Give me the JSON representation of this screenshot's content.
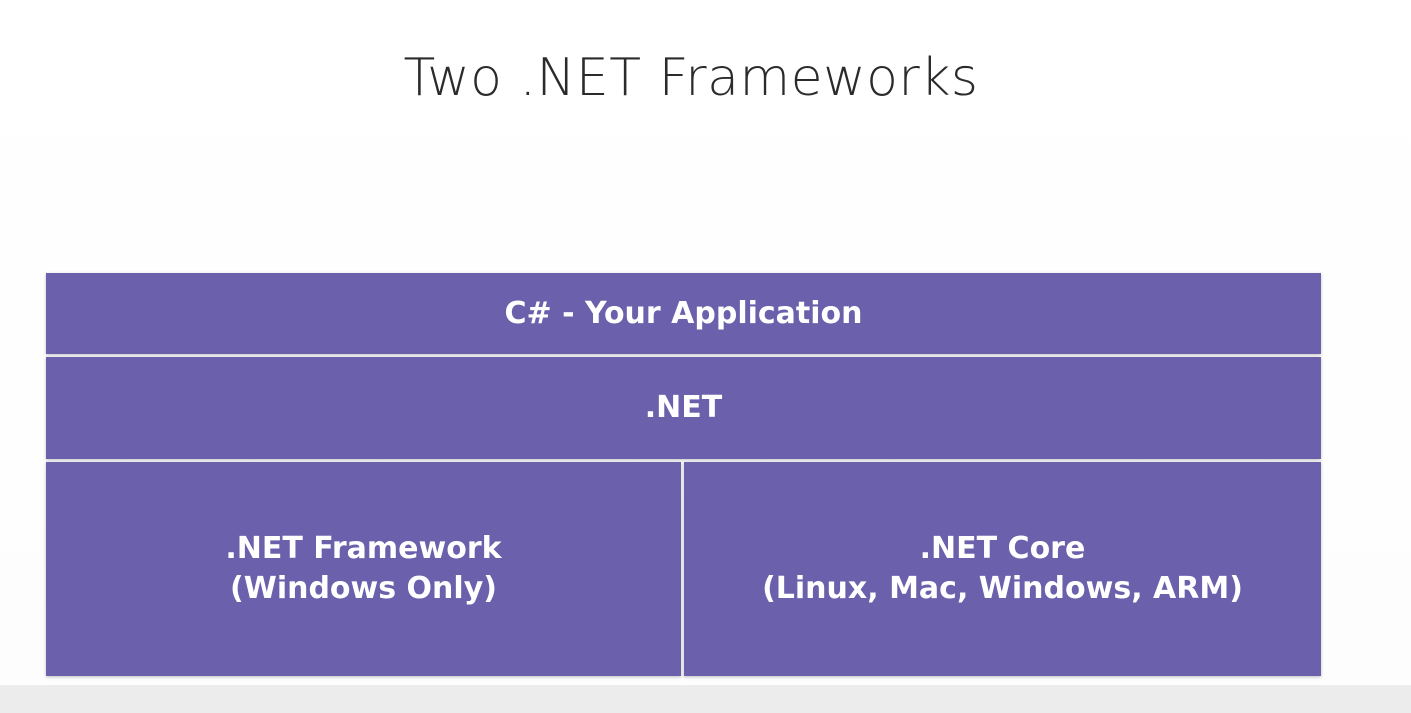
{
  "slide": {
    "title": "Two .NET Frameworks"
  },
  "diagram": {
    "app_layer": "C# - Your Application",
    "net_layer": ".NET",
    "framework": {
      "line1": ".NET Framework",
      "line2": "(Windows Only)"
    },
    "core": {
      "line1": ".NET Core",
      "line2": "(Linux, Mac, Windows, ARM)"
    }
  },
  "colors": {
    "block_fill": "#6a60ab",
    "block_text": "#ffffff",
    "title_text": "#2b2b2b"
  }
}
